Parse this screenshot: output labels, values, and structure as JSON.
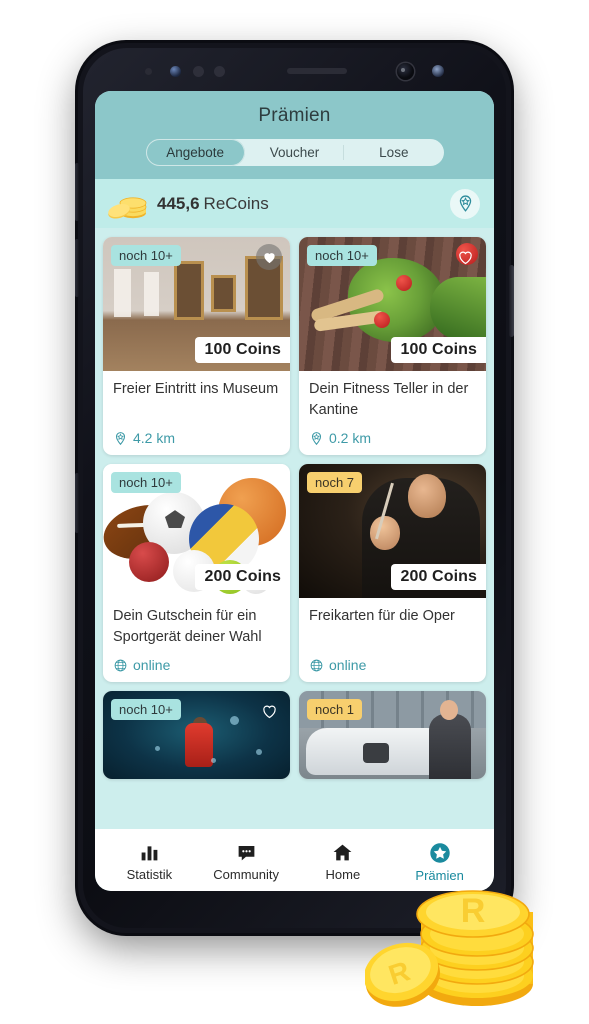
{
  "app": {
    "header": {
      "title": "Prämien",
      "tabs": [
        {
          "label": "Angebote",
          "active": true
        },
        {
          "label": "Voucher",
          "active": false
        },
        {
          "label": "Lose",
          "active": false
        }
      ]
    },
    "balance_bar": {
      "amount": "445,6",
      "currency": "ReCoins",
      "coin_icon": "coin-stack-icon",
      "map_button_icon": "map-pin-star-icon"
    },
    "cards": [
      {
        "badge": "noch 10+",
        "badge_style": "teal",
        "price": "100 Coins",
        "title": "Freier Eintritt ins Museum",
        "meta_icon": "map-pin-star-icon",
        "meta": "4.2 km",
        "favorite_icon": "heart-filled-icon",
        "image": "museum-gallery-photo"
      },
      {
        "badge": "noch 10+",
        "badge_style": "teal",
        "price": "100 Coins",
        "title": "Dein Fitness Teller in der Kantine",
        "meta_icon": "map-pin-star-icon",
        "meta": "0.2 km",
        "favorite_icon": "heart-outline-icon",
        "image": "salad-bowl-photo"
      },
      {
        "badge": "noch 10+",
        "badge_style": "teal",
        "price": "200 Coins",
        "title": "Dein Gutschein für ein Sportgerät deiner Wahl",
        "meta_icon": "globe-icon",
        "meta": "online",
        "favorite_icon": "none",
        "image": "sport-balls-photo"
      },
      {
        "badge": "noch 7",
        "badge_style": "amber",
        "price": "200 Coins",
        "title": "Freikarten für die Oper",
        "meta_icon": "globe-icon",
        "meta": "online",
        "favorite_icon": "none",
        "image": "opera-conductor-photo"
      },
      {
        "badge": "noch 10+",
        "badge_style": "teal",
        "price": "",
        "title": "",
        "meta_icon": "none",
        "meta": "",
        "favorite_icon": "heart-outline-icon",
        "image": "stadium-fan-photo"
      },
      {
        "badge": "noch 1",
        "badge_style": "amber",
        "price": "",
        "title": "",
        "meta_icon": "none",
        "meta": "",
        "favorite_icon": "none",
        "image": "ev-charging-photo"
      }
    ],
    "bottom_nav": [
      {
        "label": "Statistik",
        "icon": "bar-chart-icon",
        "active": false
      },
      {
        "label": "Community",
        "icon": "chat-bubble-icon",
        "active": false
      },
      {
        "label": "Home",
        "icon": "home-icon",
        "active": false
      },
      {
        "label": "Prämien",
        "icon": "star-circle-icon",
        "active": true
      }
    ],
    "decoration": {
      "coin_pile": "gold-coin-stack-illustration"
    },
    "colors": {
      "header_teal": "#8cc7c9",
      "balance_bar_teal": "#bfece9",
      "page_bg_teal": "#cdeeed",
      "accent_teal": "#1a8a9e",
      "badge_teal": "#a9e3e0",
      "badge_amber": "#f7cf6e",
      "coin_gold": "#fcd53f"
    }
  }
}
